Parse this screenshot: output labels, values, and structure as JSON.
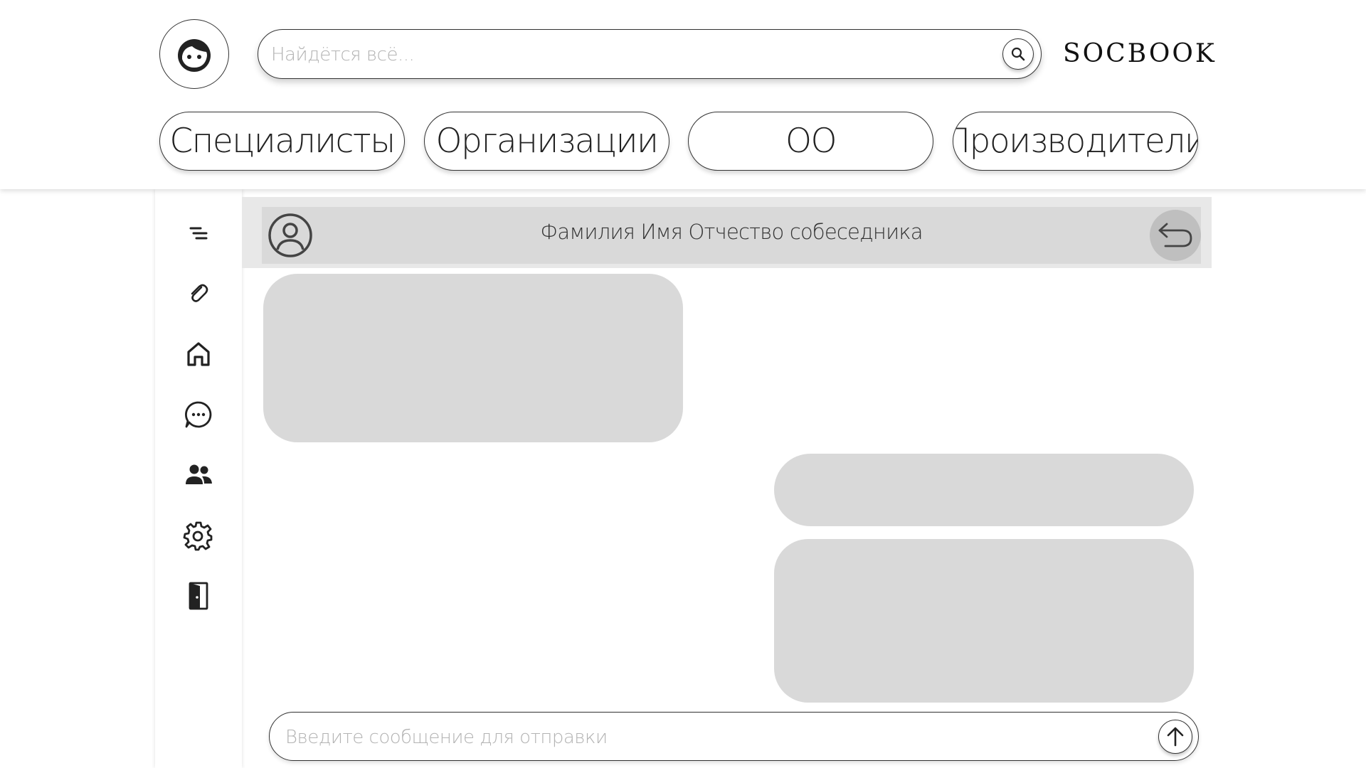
{
  "header": {
    "avatar_icon": "child-face-icon",
    "search": {
      "placeholder": "Найдётся всё...",
      "value": "",
      "icon": "search-icon"
    },
    "logo": "SOCBOOK"
  },
  "tabs": [
    {
      "label": "Специалисты"
    },
    {
      "label": "Организации"
    },
    {
      "label": "ОО"
    },
    {
      "label": "Производители"
    }
  ],
  "sidebar": {
    "items": [
      {
        "icon": "menu-lines-icon"
      },
      {
        "icon": "paperclip-icon"
      },
      {
        "icon": "home-icon"
      },
      {
        "icon": "chat-bubble-icon"
      },
      {
        "icon": "users-icon"
      },
      {
        "icon": "gear-icon"
      },
      {
        "icon": "exit-door-icon"
      }
    ]
  },
  "chat": {
    "partner_name": "Фамилия Имя Отчество собеседника",
    "partner_icon": "user-circle-icon",
    "back_icon": "undo-arrow-icon",
    "messages": [
      {
        "side": "incoming"
      },
      {
        "side": "outgoing"
      },
      {
        "side": "outgoing"
      }
    ]
  },
  "composer": {
    "placeholder": "Введите сообщение для отправки",
    "value": "",
    "send_icon": "arrow-up-icon"
  },
  "colors": {
    "border": "#333333",
    "bubble": "#d9d9d9",
    "header_bar": "#e8e8e8",
    "back_button": "#bfbfbf",
    "placeholder": "#b3b3b3"
  }
}
